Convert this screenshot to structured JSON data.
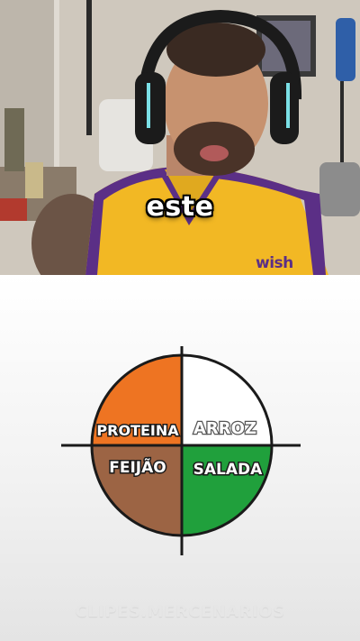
{
  "video": {
    "caption": "este",
    "jersey_text": "wish"
  },
  "plate": {
    "quadrants": [
      {
        "label": "PROTEINA",
        "color": "#ee7422",
        "position": "top-left"
      },
      {
        "label": "ARROZ",
        "color": "#ffffff",
        "position": "top-right"
      },
      {
        "label": "FEIJÃO",
        "color": "#9c6444",
        "position": "bottom-left"
      },
      {
        "label": "SALADA",
        "color": "#20a03c",
        "position": "bottom-right"
      }
    ]
  },
  "watermark": "CLIPES.MERCENARIOS",
  "colors": {
    "caption_text": "#ffffff",
    "jersey_yellow": "#f2b824",
    "jersey_purple": "#5b2f86",
    "headset": "#1b1b1b"
  }
}
